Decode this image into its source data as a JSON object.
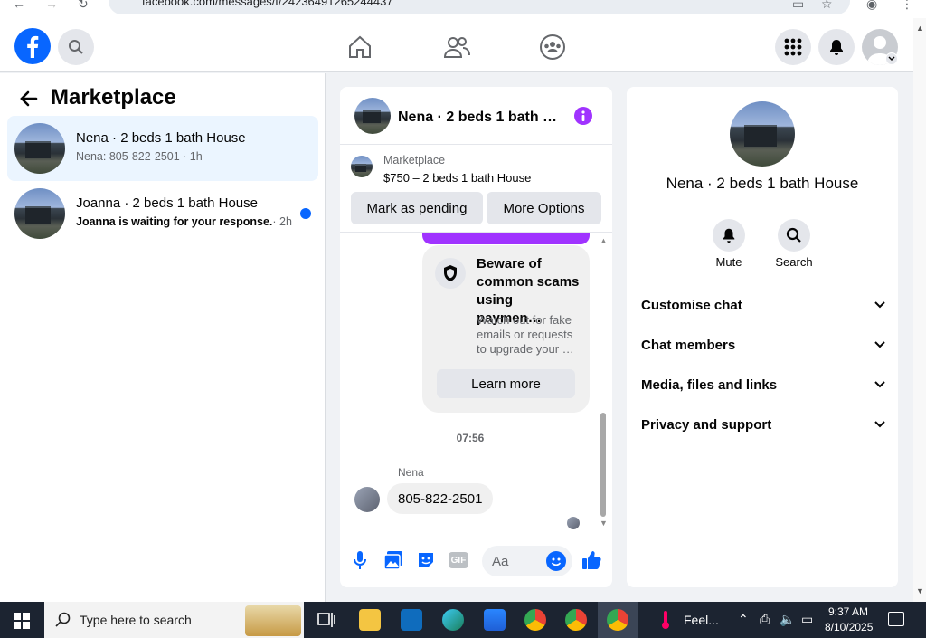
{
  "browser": {
    "url": "facebook.com/messages/t/24236491265244437"
  },
  "topbar": {
    "logo": "facebook-logo",
    "icons": [
      "search-icon",
      "home-icon",
      "friends-icon",
      "groups-icon",
      "menu-grid-icon",
      "notifications-icon",
      "profile-avatar"
    ]
  },
  "left": {
    "title": "Marketplace",
    "conversations": [
      {
        "name": "Nena · 2 beds 1 bath House",
        "preview": "Nena: 805-822-2501 · 1h",
        "active": true,
        "unread": false
      },
      {
        "name": "Joanna · 2 beds 1 bath House",
        "preview": "Joanna is waiting for your response.",
        "time": "· 2h",
        "active": false,
        "unread": true
      }
    ]
  },
  "chat": {
    "header_title": "Nena · 2 beds 1 bath …",
    "listing_source": "Marketplace",
    "listing_price": "$750 – 2 beds 1 bath House",
    "mark_pending": "Mark as pending",
    "more_options": "More Options",
    "scam_title": "Beware of common scams using paymen…",
    "scam_body": "Watch out for fake emails or requests to upgrade your …",
    "learn_more": "Learn more",
    "timestamp": "07:56",
    "sender": "Nena",
    "message": "805-822-2501",
    "composer_placeholder": "Aa"
  },
  "info": {
    "name": "Nena · 2 beds 1 bath House",
    "actions": [
      {
        "label": "Mute",
        "icon": "bell-icon"
      },
      {
        "label": "Search",
        "icon": "search-icon"
      }
    ],
    "sections": [
      "Customise chat",
      "Chat members",
      "Media, files and links",
      "Privacy and support"
    ]
  },
  "taskbar": {
    "search_placeholder": "Type here to search",
    "weather": "Feel...",
    "time": "9:37 AM",
    "date": "8/10/2025"
  },
  "colors": {
    "fb_blue": "#0866ff",
    "purple": "#a033ff",
    "taskbar": "#1c2431"
  }
}
